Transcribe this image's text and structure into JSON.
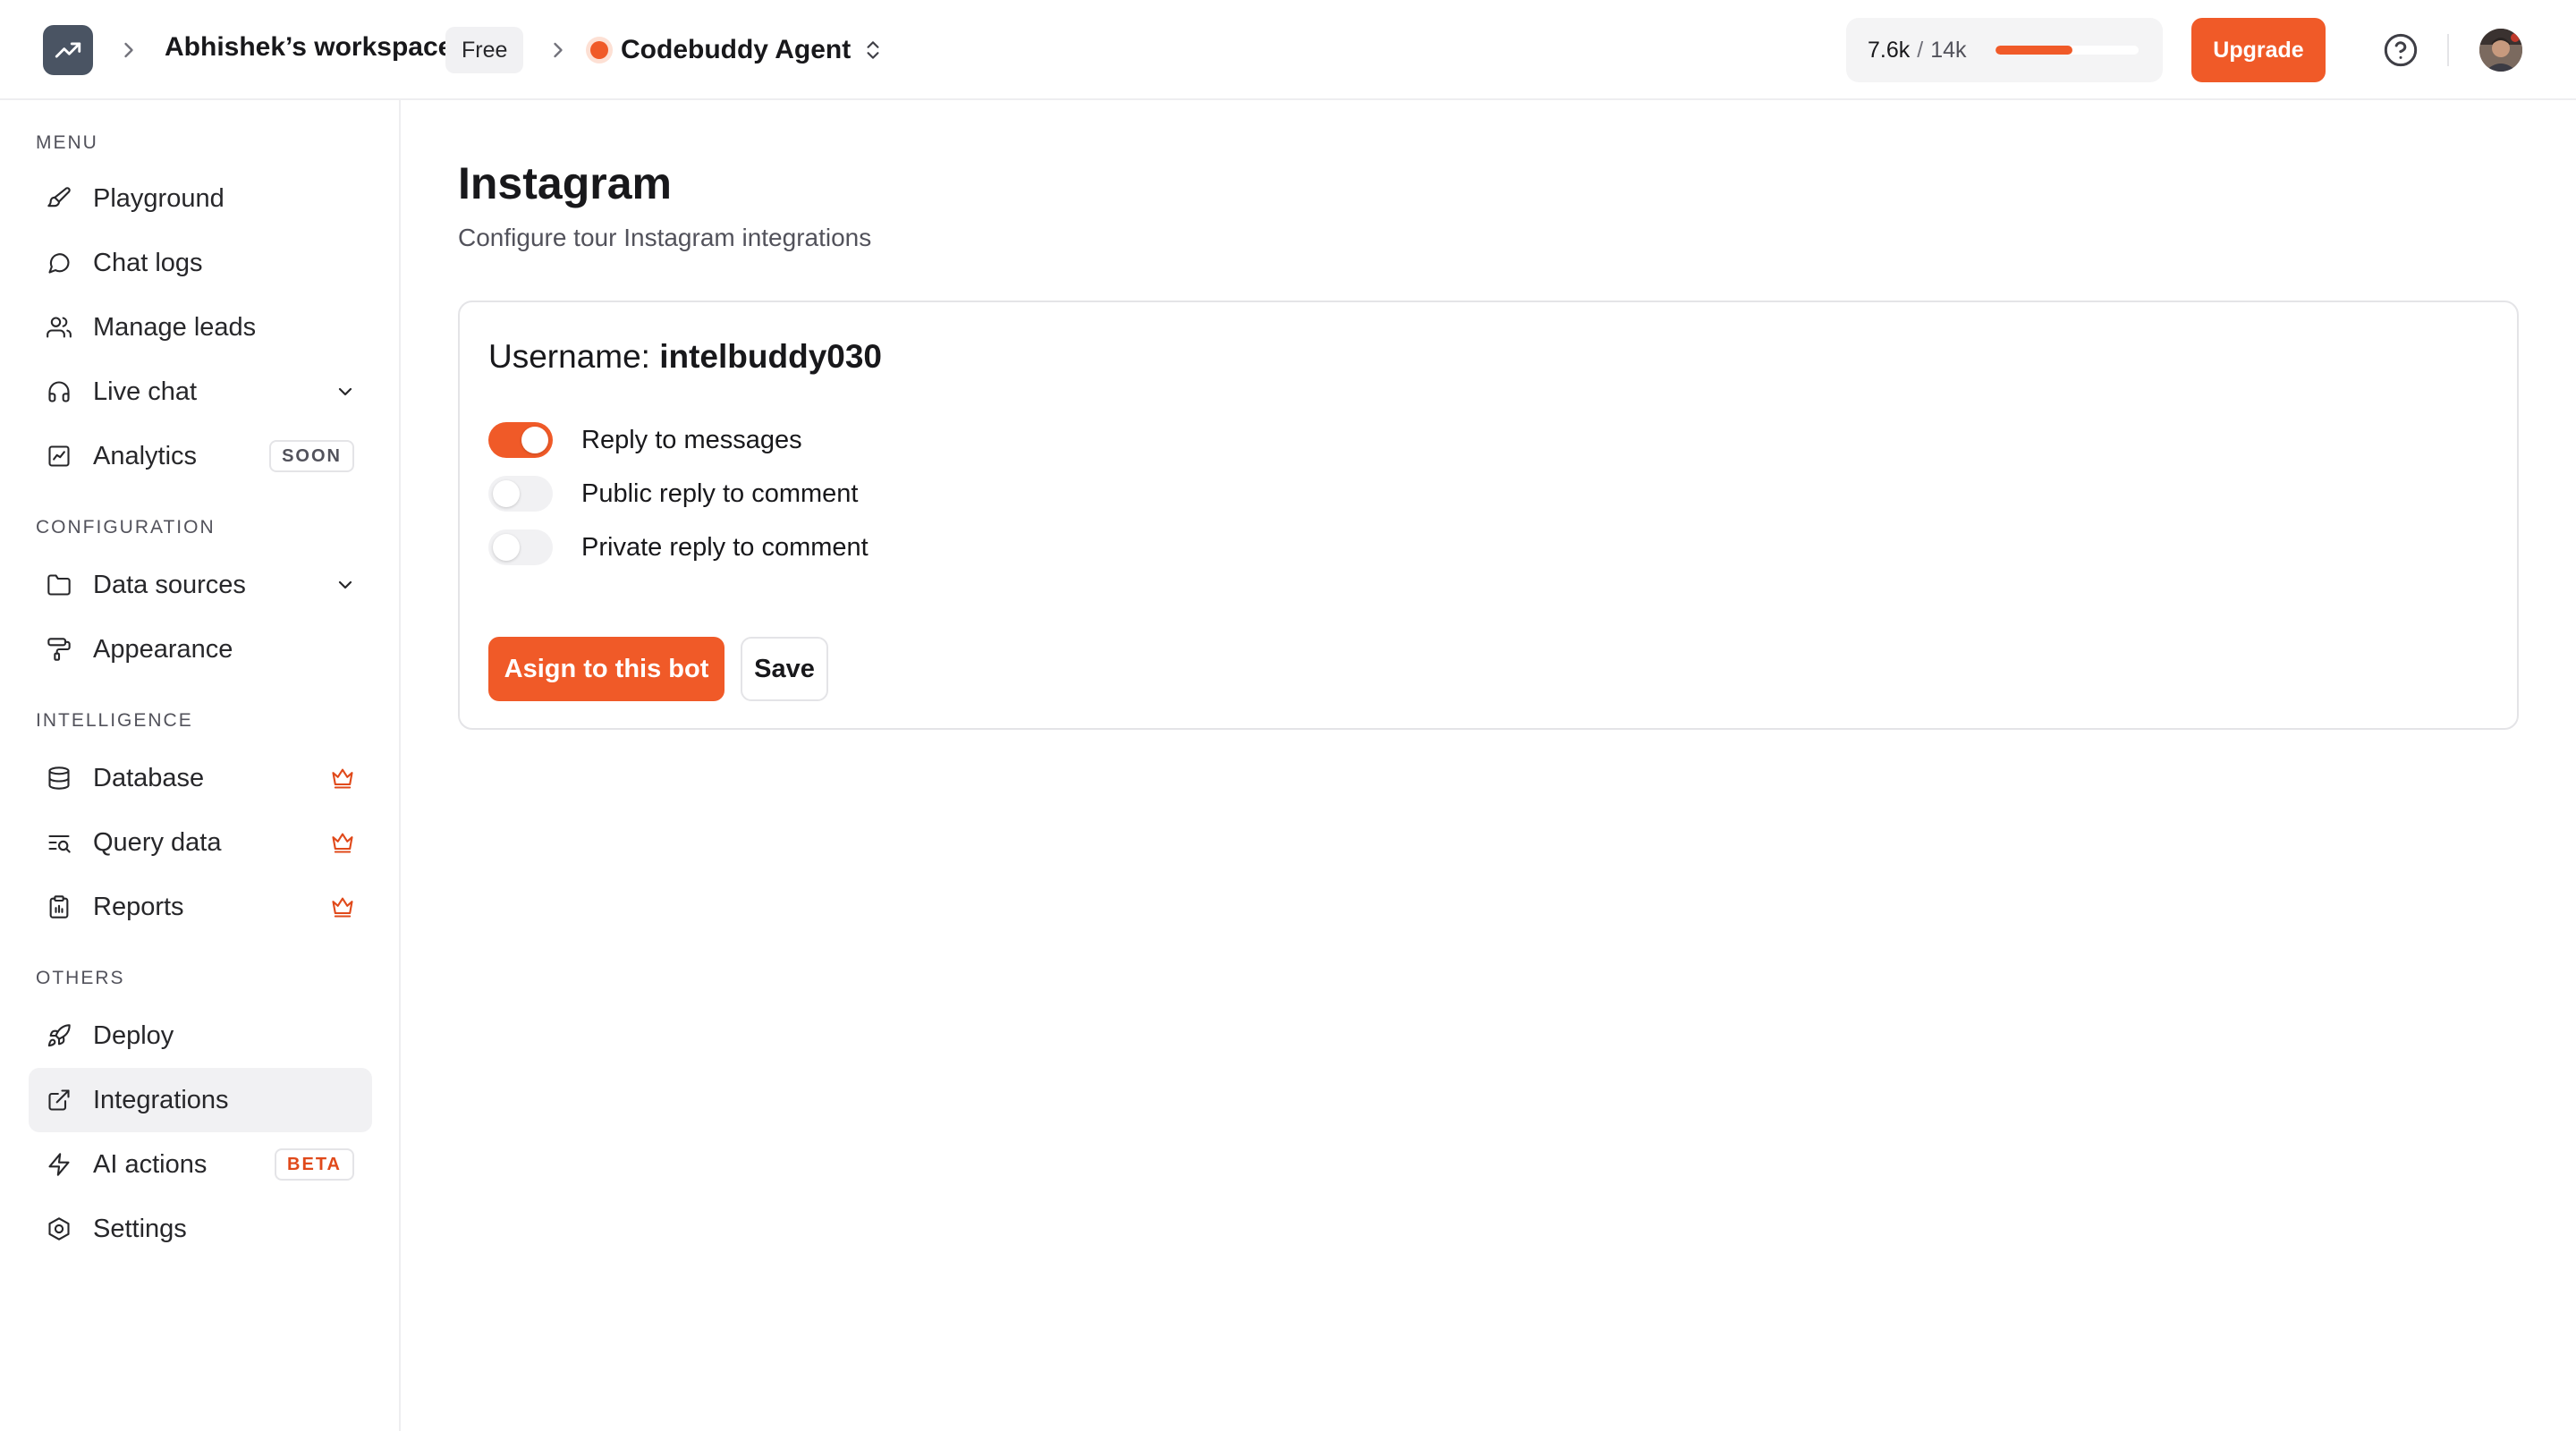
{
  "header": {
    "logo_icon": "trending-up-icon",
    "workspace_name": "Abhishek’s workspace",
    "plan_badge": "Free",
    "agent_name": "Codebuddy Agent",
    "usage": {
      "used": "7.6k",
      "separator": "/",
      "total": "14k",
      "progress": 0.54
    },
    "upgrade_label": "Upgrade",
    "help_icon": "help-circle-icon",
    "accent_color": "#f05a28"
  },
  "sidebar": {
    "sections": {
      "menu": "MENU",
      "configuration": "CONFIGURATION",
      "intelligence": "INTELLIGENCE",
      "others": "OTHERS"
    },
    "items": [
      {
        "label": "Playground",
        "icon": "brush-icon"
      },
      {
        "label": "Chat logs",
        "icon": "message-circle-icon"
      },
      {
        "label": "Manage leads",
        "icon": "users-icon"
      },
      {
        "label": "Live chat",
        "icon": "headphones-icon",
        "has_dropdown": true
      },
      {
        "label": "Analytics",
        "icon": "chart-icon",
        "pill": "SOON"
      },
      {
        "label": "Data sources",
        "icon": "folder-icon",
        "has_dropdown": true
      },
      {
        "label": "Appearance",
        "icon": "paint-roller-icon"
      },
      {
        "label": "Database",
        "icon": "database-icon",
        "premium": true
      },
      {
        "label": "Query data",
        "icon": "text-search-icon",
        "premium": true
      },
      {
        "label": "Reports",
        "icon": "clipboard-chart-icon",
        "premium": true
      },
      {
        "label": "Deploy",
        "icon": "rocket-icon"
      },
      {
        "label": "Integrations",
        "icon": "external-link-icon",
        "active": true
      },
      {
        "label": "AI actions",
        "icon": "zap-icon",
        "pill": "BETA"
      },
      {
        "label": "Settings",
        "icon": "settings-icon"
      }
    ]
  },
  "main": {
    "title": "Instagram",
    "subtitle": "Configure tour Instagram integrations",
    "card": {
      "username_label": "Username:",
      "username_value": "intelbuddy030",
      "toggles": [
        {
          "label": "Reply to messages",
          "on": true
        },
        {
          "label": "Public reply to comment",
          "on": false
        },
        {
          "label": "Private reply to comment",
          "on": false
        }
      ],
      "assign_label": "Asign to this bot",
      "save_label": "Save"
    }
  }
}
